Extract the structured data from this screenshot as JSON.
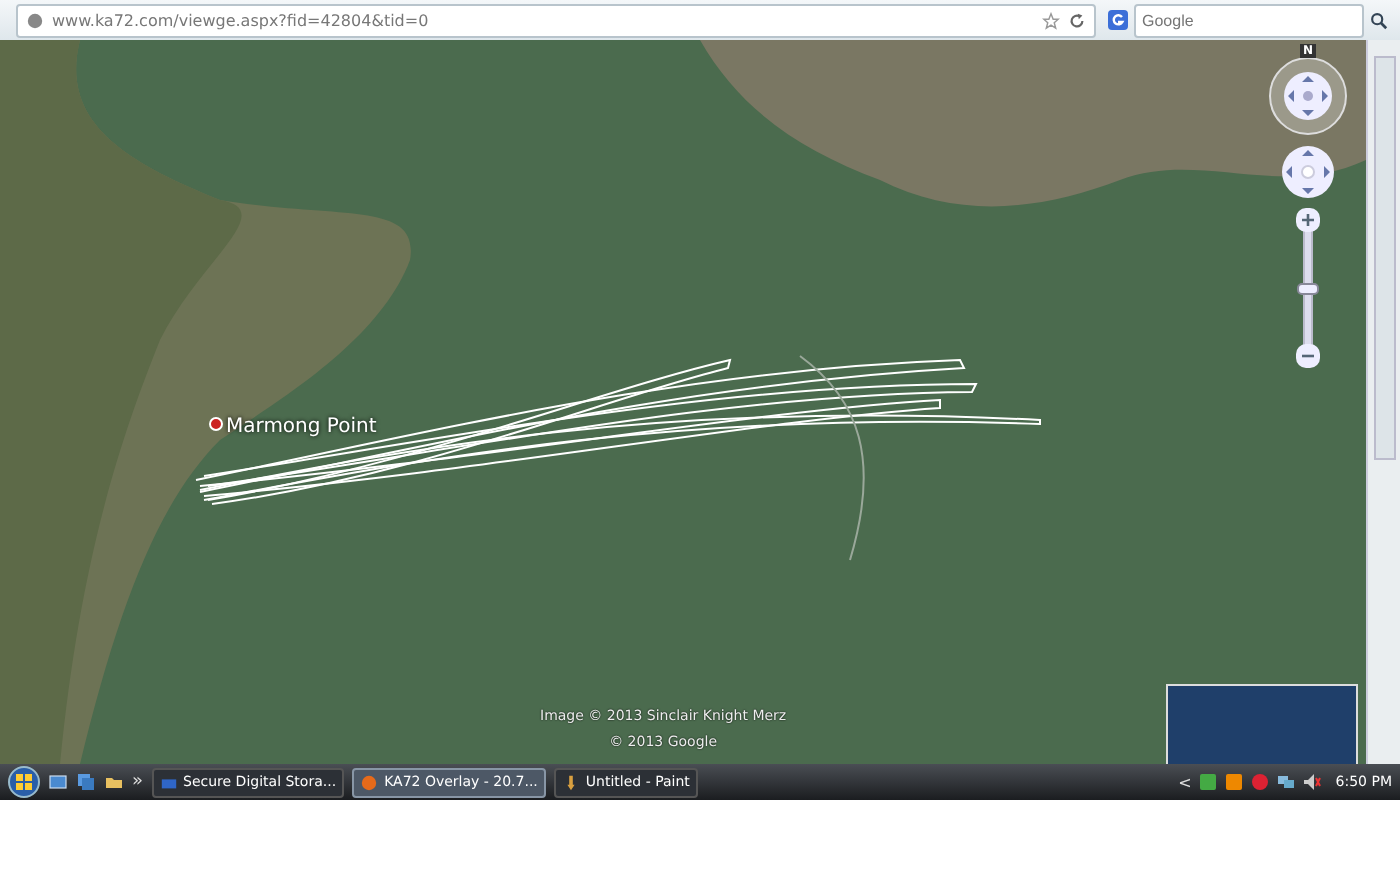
{
  "address_bar": {
    "url": "www.ka72.com/viewge.aspx?fid=42804&tid=0"
  },
  "search": {
    "placeholder": "Google"
  },
  "map": {
    "place_label": "Marmong Point",
    "compass_label": "N",
    "attributions": [
      "Image © 2013 Sinclair Knight Merz",
      "© 2013 Google"
    ]
  },
  "taskbar": {
    "overflow": "»",
    "tasks": [
      {
        "label": "Secure Digital Stora...",
        "kind": "drive",
        "selected": false
      },
      {
        "label": "KA72 Overlay - 20.7...",
        "kind": "browser",
        "selected": true
      },
      {
        "label": "Untitled - Paint",
        "kind": "paint",
        "selected": false
      }
    ],
    "tray_expand": "<",
    "clock": "6:50 PM"
  }
}
